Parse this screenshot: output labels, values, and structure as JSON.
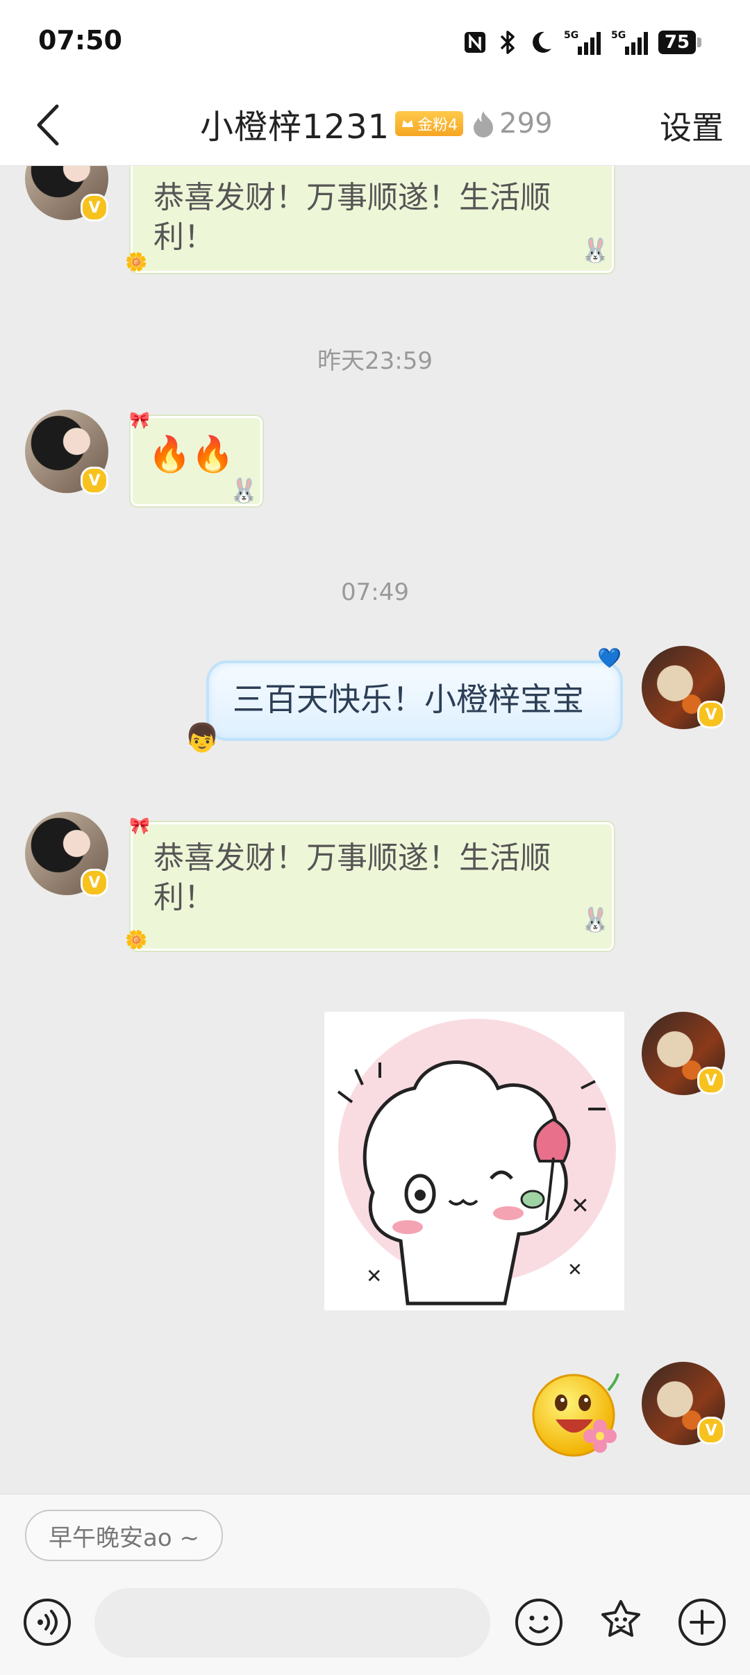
{
  "status_bar": {
    "time": "07:50",
    "battery": "75",
    "icons": [
      "nfc-icon",
      "bluetooth-icon",
      "dnd-moon-icon",
      "signal-5g-icon",
      "signal-5g-icon"
    ]
  },
  "header": {
    "title": "小橙梓1231",
    "fan_badge": "金粉4",
    "flame_count": "299",
    "settings": "设置"
  },
  "messages": [
    {
      "side": "left",
      "type": "text",
      "text": "恭喜发财！万事顺遂！生活顺利！"
    },
    {
      "type": "timestamp",
      "text": "昨天23:59"
    },
    {
      "side": "left",
      "type": "text",
      "text": "🔥🔥"
    },
    {
      "type": "timestamp",
      "text": "07:49"
    },
    {
      "side": "right",
      "type": "text",
      "text": "三百天快乐！小橙梓宝宝"
    },
    {
      "side": "left",
      "type": "text",
      "text": "恭喜发财！万事顺遂！生活顺利！"
    },
    {
      "side": "right",
      "type": "sticker",
      "icon": "bunny-flower-sticker"
    },
    {
      "side": "right",
      "type": "emoji",
      "icon": "smiley-flower-emoji"
    }
  ],
  "composer": {
    "quick_reply": "早午晚安ao ~",
    "input_placeholder": ""
  },
  "colors": {
    "accent_badge": "#f5a623",
    "verified": "#f7c21d",
    "green_bubble": "#eef6d8",
    "blue_bubble": "#dff0ff"
  }
}
